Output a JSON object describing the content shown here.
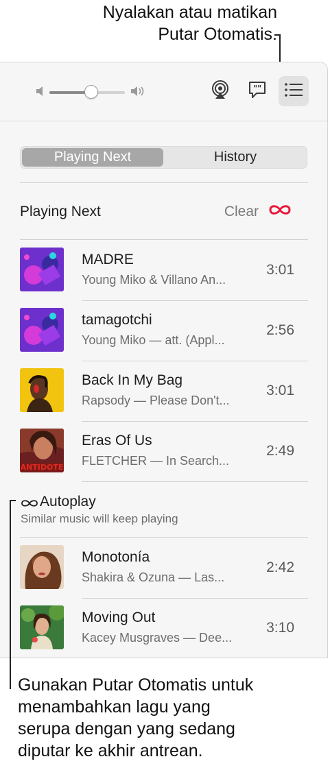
{
  "callouts": {
    "top_line1": "Nyalakan atau matikan",
    "top_line2": "Putar Otomatis.",
    "bottom_line1": "Gunakan Putar Otomatis untuk",
    "bottom_line2": "menambahkan lagu yang",
    "bottom_line3": "serupa dengan yang sedang",
    "bottom_line4": "diputar ke akhir antrean."
  },
  "toolbar": {
    "volume_level": 0.55,
    "icons": [
      "volume-low-icon",
      "volume-high-icon",
      "airplay-icon",
      "lyrics-icon",
      "queue-list-icon"
    ]
  },
  "segment": {
    "playing_next": "Playing Next",
    "history": "History"
  },
  "queue_header": {
    "title": "Playing Next",
    "clear": "Clear"
  },
  "queue": [
    {
      "title": "MADRE",
      "subtitle": "Young Miko & Villano An...",
      "duration": "3:01"
    },
    {
      "title": "tamagotchi",
      "subtitle": "Young Miko — att. (Appl...",
      "duration": "2:56"
    },
    {
      "title": "Back In My Bag",
      "subtitle": "Rapsody — Please Don't...",
      "duration": "3:01"
    },
    {
      "title": "Eras Of Us",
      "subtitle": "FLETCHER — In Search...",
      "duration": "2:49",
      "art_text": "ANTIDOTE"
    }
  ],
  "autoplay": {
    "title": "Autoplay",
    "subtitle": "Similar music will keep playing"
  },
  "autoplay_tracks": [
    {
      "title": "Monotonía",
      "subtitle": "Shakira & Ozuna — Las...",
      "duration": "2:42"
    },
    {
      "title": "Moving Out",
      "subtitle": "Kacey Musgraves — Dee...",
      "duration": "3:10"
    }
  ],
  "colors": {
    "accent_red": "#e8173a",
    "segment_selected": "#a7a7a7",
    "panel_bg": "#f6f6f6"
  }
}
